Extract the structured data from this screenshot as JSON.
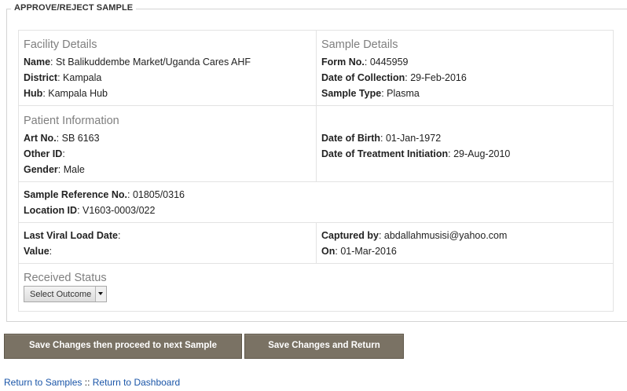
{
  "form": {
    "legend": "APPROVE/REJECT SAMPLE",
    "facility": {
      "heading": "Facility Details",
      "name_label": "Name",
      "name_value": "St Balikuddembe Market/Uganda Cares AHF",
      "district_label": "District",
      "district_value": "Kampala",
      "hub_label": "Hub",
      "hub_value": "Kampala Hub"
    },
    "sample": {
      "heading": "Sample Details",
      "form_no_label": "Form No.",
      "form_no_value": "0445959",
      "collection_label": "Date of Collection",
      "collection_value": "29-Feb-2016",
      "type_label": "Sample Type",
      "type_value": "Plasma"
    },
    "patient": {
      "heading": "Patient Information",
      "art_label": "Art No.",
      "art_value": "SB 6163",
      "other_id_label": "Other ID",
      "other_id_value": "",
      "gender_label": "Gender",
      "gender_value": "Male",
      "dob_label": "Date of Birth",
      "dob_value": "01-Jan-1972",
      "treatment_label": "Date of Treatment Initiation",
      "treatment_value": "29-Aug-2010"
    },
    "reference": {
      "ref_label": "Sample Reference No.",
      "ref_value": "01805/0316",
      "location_label": "Location ID",
      "location_value": "V1603-0003/022"
    },
    "viral_load": {
      "last_date_label": "Last Viral Load Date",
      "last_date_value": "",
      "value_label": "Value",
      "value_value": "",
      "captured_label": "Captured by",
      "captured_value": "abdallahmusisi@yahoo.com",
      "on_label": "On",
      "on_value": "01-Mar-2016"
    },
    "received": {
      "heading": "Received Status",
      "select_value": "Select Outcome"
    }
  },
  "buttons": {
    "save_next": "Save Changes then proceed to next Sample",
    "save_return": "Save Changes and Return"
  },
  "links": {
    "samples": "Return to Samples",
    "separator": "::",
    "dashboard": "Return to Dashboard"
  },
  "colors": {
    "button_bg": "#7a7264",
    "heading_gray": "#7f7f7f",
    "link_blue": "#1a55a8",
    "border": "#e3e3e3"
  },
  "icons": {
    "select_arrow": "chevron-down-icon"
  }
}
